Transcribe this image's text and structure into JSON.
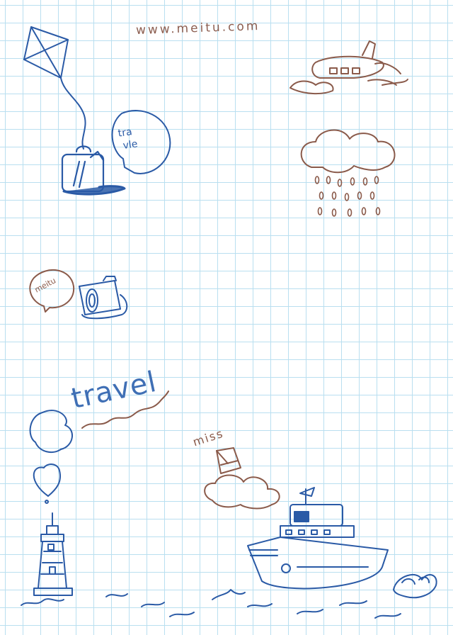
{
  "site_url": "www.meitu.com",
  "bubbles": {
    "travel_bubble": "tra\n vle",
    "meitu_bubble": "meitu"
  },
  "titles": {
    "travel": "travel",
    "miss": "miss"
  },
  "colors": {
    "grid_line": "#b9dff0",
    "blue_ink": "#2a5aa6",
    "brown_ink": "#8a5a4a"
  },
  "icons": [
    "kite-icon",
    "suitcase-icon",
    "speech-bubble-icon",
    "airplane-icon",
    "rain-cloud-icon",
    "camera-icon",
    "heart-icon",
    "lighthouse-icon",
    "ship-icon",
    "paper-boat-icon",
    "cloud-icon",
    "wave-icon"
  ]
}
